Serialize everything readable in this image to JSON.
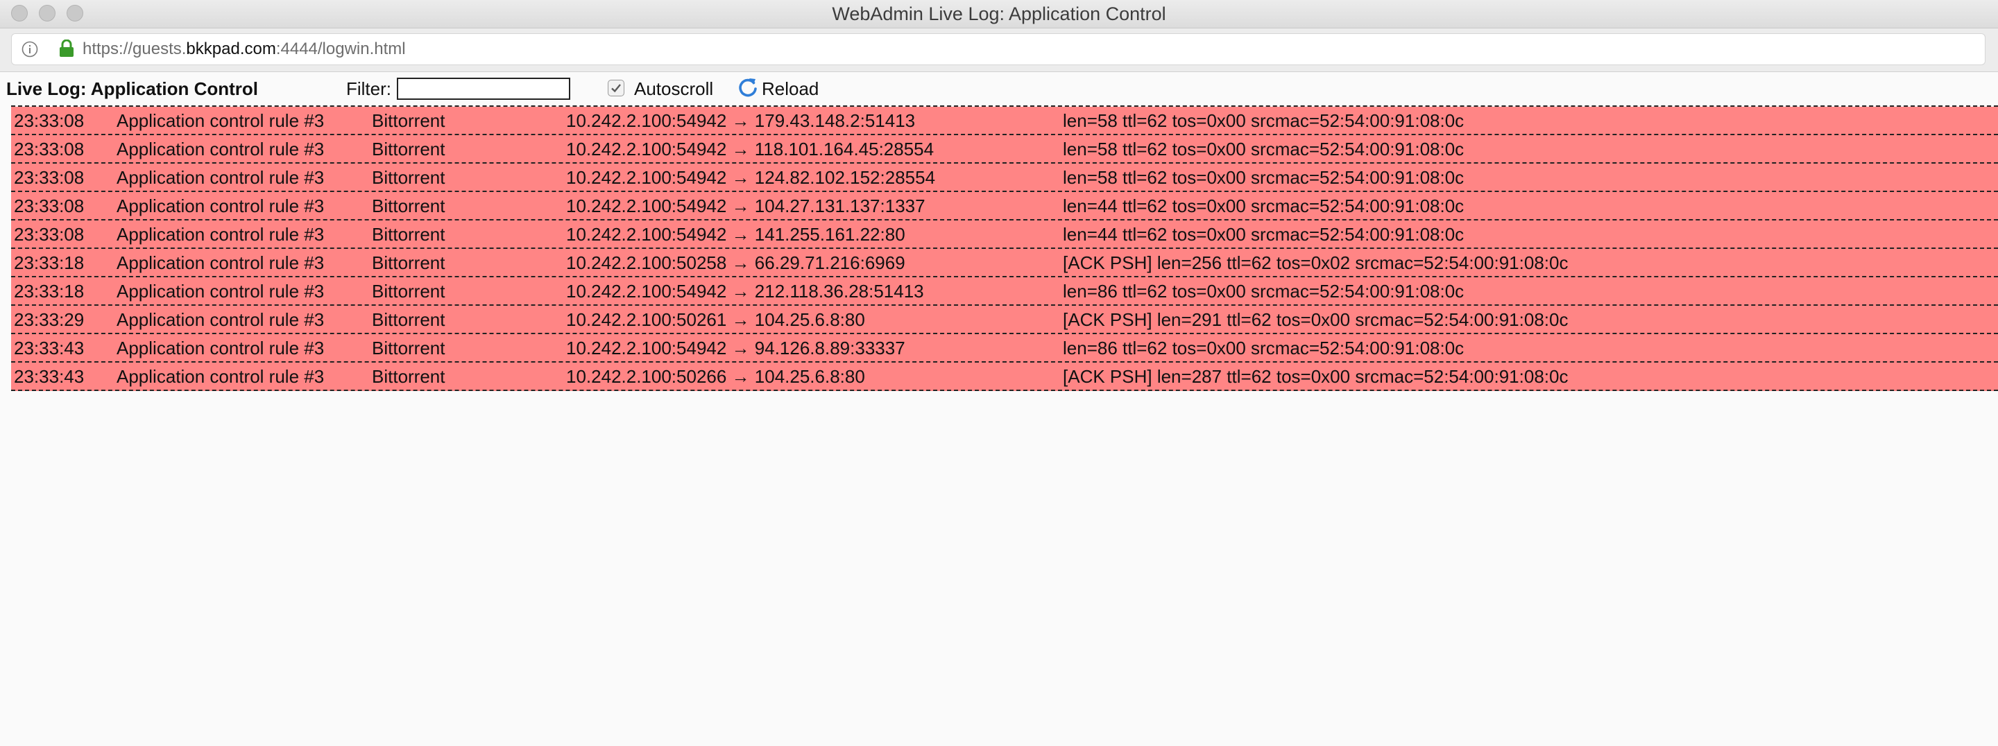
{
  "window": {
    "title": "WebAdmin Live Log: Application Control"
  },
  "addressbar": {
    "url_prefix": "https://guests.",
    "url_host": "bkkpad.com",
    "url_suffix": ":4444/logwin.html"
  },
  "toolbar": {
    "title": "Live Log: Application Control",
    "filter_label": "Filter:",
    "filter_value": "",
    "autoscroll_label": "Autoscroll",
    "autoscroll_checked": true,
    "reload_label": "Reload"
  },
  "colors": {
    "row_background": "#ff8585",
    "reload_icon": "#2f7ed8",
    "lock_icon": "#3a9a2a"
  },
  "icons": [
    "info-icon",
    "lock-icon",
    "checkbox-check-icon",
    "reload-icon"
  ],
  "log": {
    "rows": [
      {
        "time": "23:33:08",
        "rule": "Application control rule #3",
        "app": "Bittorrent",
        "conn": "10.242.2.100:54942 → 179.43.148.2:51413",
        "info": "len=58  ttl=62  tos=0x00  srcmac=52:54:00:91:08:0c"
      },
      {
        "time": "23:33:08",
        "rule": "Application control rule #3",
        "app": "Bittorrent",
        "conn": "10.242.2.100:54942 → 118.101.164.45:28554",
        "info": "len=58  ttl=62  tos=0x00  srcmac=52:54:00:91:08:0c"
      },
      {
        "time": "23:33:08",
        "rule": "Application control rule #3",
        "app": "Bittorrent",
        "conn": "10.242.2.100:54942 → 124.82.102.152:28554",
        "info": "len=58  ttl=62  tos=0x00  srcmac=52:54:00:91:08:0c"
      },
      {
        "time": "23:33:08",
        "rule": "Application control rule #3",
        "app": "Bittorrent",
        "conn": "10.242.2.100:54942 → 104.27.131.137:1337",
        "info": "len=44  ttl=62  tos=0x00  srcmac=52:54:00:91:08:0c"
      },
      {
        "time": "23:33:08",
        "rule": "Application control rule #3",
        "app": "Bittorrent",
        "conn": "10.242.2.100:54942 → 141.255.161.22:80",
        "info": "len=44  ttl=62  tos=0x00  srcmac=52:54:00:91:08:0c"
      },
      {
        "time": "23:33:18",
        "rule": "Application control rule #3",
        "app": "Bittorrent",
        "conn": "10.242.2.100:50258 → 66.29.71.216:6969",
        "info": "[ACK PSH]  len=256  ttl=62  tos=0x02  srcmac=52:54:00:91:08:0c"
      },
      {
        "time": "23:33:18",
        "rule": "Application control rule #3",
        "app": "Bittorrent",
        "conn": "10.242.2.100:54942 → 212.118.36.28:51413",
        "info": "len=86  ttl=62  tos=0x00  srcmac=52:54:00:91:08:0c"
      },
      {
        "time": "23:33:29",
        "rule": "Application control rule #3",
        "app": "Bittorrent",
        "conn": "10.242.2.100:50261 → 104.25.6.8:80",
        "info": "[ACK PSH]  len=291  ttl=62  tos=0x00  srcmac=52:54:00:91:08:0c"
      },
      {
        "time": "23:33:43",
        "rule": "Application control rule #3",
        "app": "Bittorrent",
        "conn": "10.242.2.100:54942 → 94.126.8.89:33337",
        "info": "len=86  ttl=62  tos=0x00  srcmac=52:54:00:91:08:0c"
      },
      {
        "time": "23:33:43",
        "rule": "Application control rule #3",
        "app": "Bittorrent",
        "conn": "10.242.2.100:50266 → 104.25.6.8:80",
        "info": "[ACK PSH]  len=287  ttl=62  tos=0x00  srcmac=52:54:00:91:08:0c"
      }
    ]
  }
}
